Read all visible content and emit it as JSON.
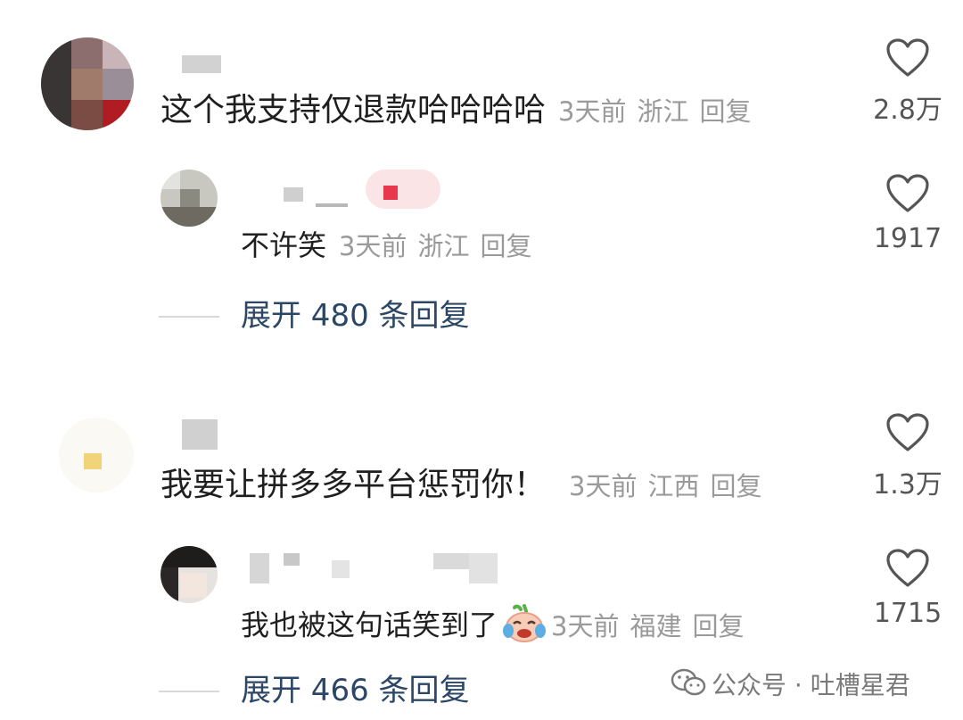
{
  "comments": [
    {
      "text": "这个我支持仅退款哈哈哈哈",
      "time": "3天前",
      "location": "浙江",
      "reply_label": "回复",
      "likes": "2.8万",
      "reply": {
        "text": "不许笑",
        "time": "3天前",
        "location": "浙江",
        "reply_label": "回复",
        "likes": "1917"
      },
      "expand_label": "展开 480 条回复"
    },
    {
      "text": "我要让拼多多平台惩罚你！",
      "time": "3天前",
      "location": "江西",
      "reply_label": "回复",
      "likes": "1.3万",
      "reply": {
        "text": "我也被这句话笑到了",
        "emoji": "crying-laughing-emoji",
        "time": "3天前",
        "location": "福建",
        "reply_label": "回复",
        "likes": "1715"
      },
      "expand_label": "展开 466 条回复"
    }
  ],
  "watermark": {
    "text": "公众号 · 吐槽星君",
    "icon": "wechat-icon"
  },
  "colors": {
    "text": "#1f1f1f",
    "meta": "#9a9a9a",
    "expand": "#2c4766",
    "heart": "#555555"
  }
}
